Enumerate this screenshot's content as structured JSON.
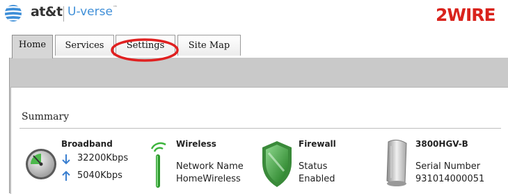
{
  "header": {
    "att_brand": "at&t",
    "uverse_brand": "U-verse",
    "uverse_trademark": "™",
    "partner_brand": "2WIRE"
  },
  "tabs": [
    {
      "label": "Home",
      "active": true
    },
    {
      "label": "Services",
      "active": false
    },
    {
      "label": "Settings",
      "active": false,
      "highlighted": true
    },
    {
      "label": "Site Map",
      "active": false
    }
  ],
  "summary": {
    "title": "Summary",
    "broadband": {
      "title": "Broadband",
      "down_rate": "32200Kbps",
      "up_rate": "5040Kbps",
      "down_icon": "arrow-down-icon",
      "up_icon": "arrow-up-icon",
      "icon": "speedometer-gauge-icon"
    },
    "wireless": {
      "title": "Wireless",
      "label": "Network Name",
      "value": "HomeWireless",
      "icon": "wireless-antenna-icon"
    },
    "firewall": {
      "title": "Firewall",
      "label": "Status",
      "value": "Enabled",
      "icon": "shield-icon"
    },
    "device": {
      "title": "3800HGV-B",
      "label": "Serial Number",
      "value": "931014000051",
      "icon": "gateway-device-icon"
    }
  },
  "colors": {
    "att_blue": "#3f8fd8",
    "twowire_red": "#d9231c",
    "highlight_red": "#e02020",
    "arrow_blue": "#3a7fd0",
    "antenna_green": "#3cb43c",
    "shield_green": "#2f9a2f"
  }
}
